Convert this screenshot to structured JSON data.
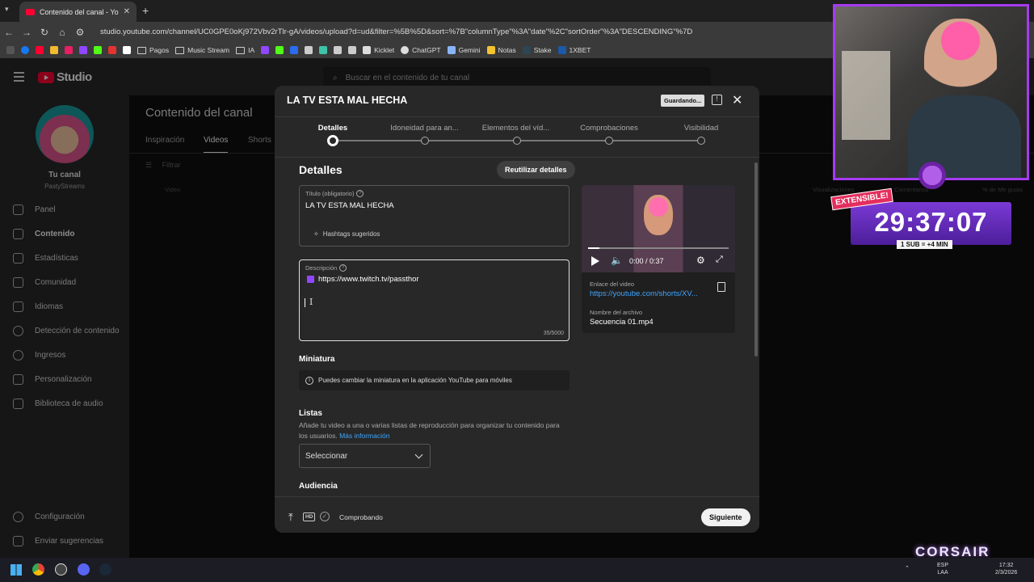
{
  "browser": {
    "tab_title": "Contenido del canal - YouTube",
    "url": "studio.youtube.com/channel/UC0GPE0oKj972Vbv2rTlr-gA/videos/upload?d=ud&filter=%5B%5D&sort=%7B\"columnType\"%3A\"date\"%2C\"sortOrder\"%3A\"DESCENDING\"%7D",
    "bookmarks": [
      "Pagos",
      "Music Stream",
      "IA",
      "Kicklet",
      "ChatGPT",
      "Gemini",
      "Notas",
      "Stake",
      "1XBET"
    ]
  },
  "studio": {
    "logo": "Studio",
    "search_placeholder": "Buscar en el contenido de tu canal"
  },
  "sidebar": {
    "channel_label": "Tu canal",
    "channel_name": "PastyStreams",
    "items": [
      "Panel",
      "Contenido",
      "Estadísticas",
      "Comunidad",
      "Idiomas",
      "Detección de contenido",
      "Ingresos",
      "Personalización",
      "Biblioteca de audio"
    ],
    "bottom": [
      "Configuración",
      "Enviar sugerencias"
    ]
  },
  "main": {
    "title": "Contenido del canal",
    "tabs": [
      "Inspiración",
      "Videos",
      "Shorts"
    ],
    "filter": "Filtrar",
    "col_video": "Video",
    "col_views": "Visualizaciones",
    "col_comments": "Comentarios",
    "col_likes": "% de Me gusta"
  },
  "modal": {
    "title": "LA TV ESTA MAL HECHA",
    "saving": "Guardando...",
    "steps": [
      "Detalles",
      "Idoneidad para an...",
      "Elementos del víd...",
      "Comprobaciones",
      "Visibilidad"
    ],
    "section_title": "Detalles",
    "reuse_label": "Reutilizar detalles",
    "title_label": "Título (obligatorio)",
    "title_value": "LA TV ESTA MAL HECHA",
    "hashtags_label": "Hashtags sugeridos",
    "desc_label": "Descripción",
    "desc_value": "https://www.twitch.tv/passthor",
    "desc_counter": "35/5000",
    "thumb_title": "Miniatura",
    "thumb_info": "Puedes cambiar la miniatura en la aplicación YouTube para móviles",
    "lists_title": "Listas",
    "lists_desc": "Añade tu video a una o varias listas de reproducción para organizar tu contenido para los usuarios.",
    "lists_link": "Más información",
    "select_label": "Seleccionar",
    "audience_title": "Audiencia",
    "video_time": "0:00 / 0:37",
    "link_label": "Enlace del video",
    "link_value": "https://youtube.com/shorts/XV...",
    "file_label": "Nombre del archivo",
    "file_value": "Secuencia 01.mp4",
    "footer_status": "Comprobando",
    "next_label": "Siguiente"
  },
  "stream_overlay": {
    "extensible": "EXTENSIBLE!",
    "timer": "29:37:07",
    "sub_rule": "1 SUB = +4 MIN",
    "brand": "CORSAIR"
  },
  "taskbar": {
    "lang1": "ESP",
    "lang2": "LAA",
    "time": "17:32",
    "date": "2/3/2026"
  }
}
